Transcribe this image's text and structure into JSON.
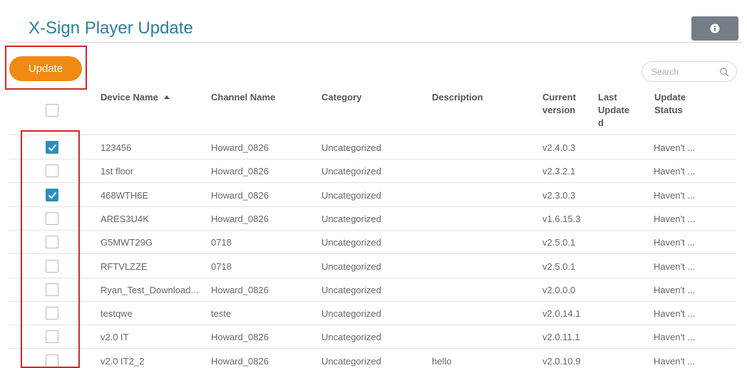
{
  "page": {
    "title": "X-Sign Player Update"
  },
  "toolbar": {
    "update_label": "Update",
    "info_icon": "info-icon"
  },
  "search": {
    "placeholder": "Search",
    "value": ""
  },
  "table": {
    "columns": {
      "device_name": "Device Name",
      "channel_name": "Channel Name",
      "category": "Category",
      "description": "Description",
      "current_version_1": "Current",
      "current_version_2": "version",
      "last_updated_1": "Last",
      "last_updated_2": "Update",
      "last_updated_3": "d",
      "update_status_1": "Update",
      "update_status_2": "Status"
    },
    "sort": {
      "column": "Device Name",
      "direction": "ascending"
    },
    "select_all_checked": false,
    "rows": [
      {
        "checked": true,
        "device": "123456",
        "channel": "Howard_0826",
        "category": "Uncategorized",
        "description": "",
        "version": "v2.4.0.3",
        "last_updated": "",
        "status": "Haven't ..."
      },
      {
        "checked": false,
        "device": "1st floor",
        "channel": "Howard_0826",
        "category": "Uncategorized",
        "description": "",
        "version": "v2.3.2.1",
        "last_updated": "",
        "status": "Haven't ..."
      },
      {
        "checked": true,
        "device": "468WTH6E",
        "channel": "Howard_0826",
        "category": "Uncategorized",
        "description": "",
        "version": "v2.3.0.3",
        "last_updated": "",
        "status": "Haven't ..."
      },
      {
        "checked": false,
        "device": "ARES3U4K",
        "channel": "Howard_0826",
        "category": "Uncategorized",
        "description": "",
        "version": "v1.6.15.3",
        "last_updated": "",
        "status": "Haven't ..."
      },
      {
        "checked": false,
        "device": "G5MWT29G",
        "channel": "0718",
        "category": "Uncategorized",
        "description": "",
        "version": "v2.5.0.1",
        "last_updated": "",
        "status": "Haven't ..."
      },
      {
        "checked": false,
        "device": "RFTVLZZE",
        "channel": "0718",
        "category": "Uncategorized",
        "description": "",
        "version": "v2.5.0.1",
        "last_updated": "",
        "status": "Haven't ..."
      },
      {
        "checked": false,
        "device": "Ryan_Test_Download...",
        "channel": "Howard_0826",
        "category": "Uncategorized",
        "description": "",
        "version": "v2.0.0.0",
        "last_updated": "",
        "status": "Haven't ..."
      },
      {
        "checked": false,
        "device": "testqwe",
        "channel": "teste",
        "category": "Uncategorized",
        "description": "",
        "version": "v2.0.14.1",
        "last_updated": "",
        "status": "Haven't ..."
      },
      {
        "checked": false,
        "device": "v2.0 IT",
        "channel": "Howard_0826",
        "category": "Uncategorized",
        "description": "",
        "version": "v2.0.11.1",
        "last_updated": "",
        "status": "Haven't ..."
      },
      {
        "checked": false,
        "device": "v2.0 IT2_2",
        "channel": "Howard_0826",
        "category": "Uncategorized",
        "description": "hello",
        "version": "v2.0.10.9",
        "last_updated": "",
        "status": "Haven't ..."
      }
    ]
  },
  "colors": {
    "title": "#2a7fa0",
    "update_button": "#f08a14",
    "info_button": "#747e86",
    "checkbox_checked": "#2b8fbd",
    "highlight_box": "#d9242a"
  }
}
